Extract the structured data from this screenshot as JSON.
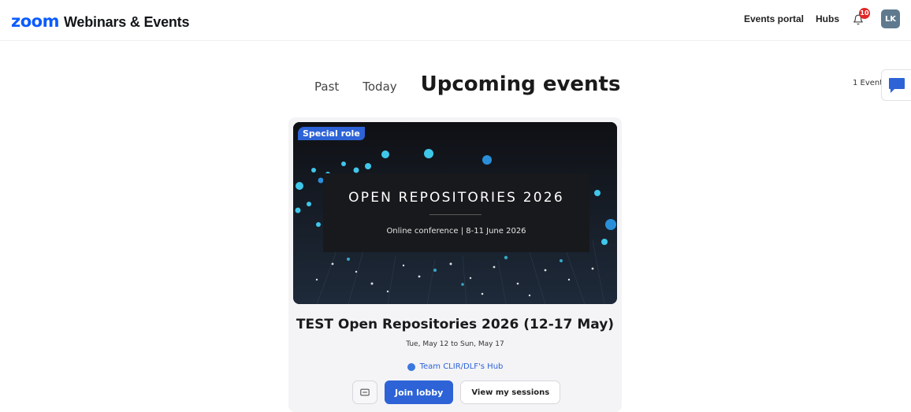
{
  "header": {
    "logo_text": "zoom",
    "product_name": "Webinars & Events",
    "nav": {
      "events_portal": "Events portal",
      "hubs": "Hubs"
    },
    "notifications_count": "10",
    "avatar_initials": "LK"
  },
  "tabs": {
    "past": "Past",
    "today": "Today",
    "upcoming": "Upcoming events"
  },
  "event_count": "1 Event",
  "card": {
    "badge": "Special role",
    "banner": {
      "heading": "OPEN REPOSITORIES 2026",
      "subheading": "Online conference | 8-11 June 2026"
    },
    "title": "TEST Open Repositories 2026 (12-17 May)",
    "dates": "Tue, May 12 to Sun, May 17",
    "hub_name": "Team CLIR/DLF's Hub",
    "buttons": {
      "join_lobby": "Join lobby",
      "view_sessions": "View my sessions"
    }
  },
  "colors": {
    "brand_blue": "#0b5cff",
    "primary_button": "#2d63d6",
    "badge_red": "#e02828"
  }
}
